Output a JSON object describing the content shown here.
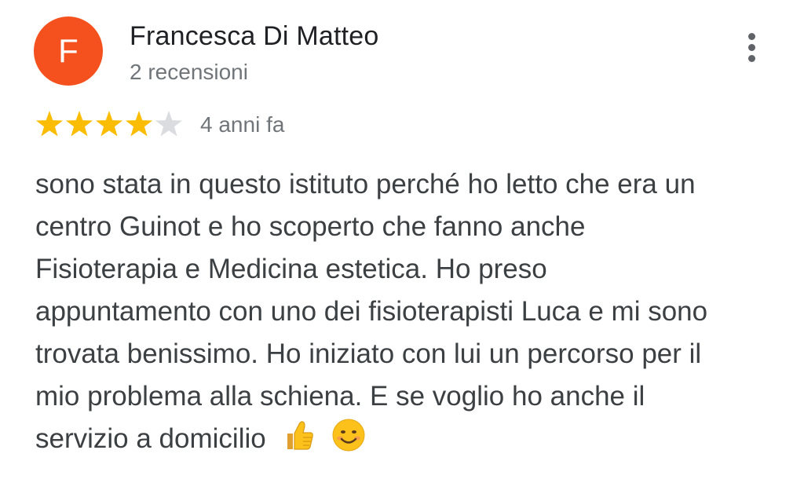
{
  "review": {
    "avatar_letter": "F",
    "avatar_color": "#f4511e",
    "author_name": "Francesca Di Matteo",
    "review_count": "2 recensioni",
    "rating": 4,
    "rating_max": 5,
    "star_color": "#fbbc04",
    "star_empty_color": "#dadce0",
    "date": "4 anni fa",
    "text": "sono stata in questo istituto perché ho letto che era un centro Guinot e ho scoperto che fanno anche Fisioterapia e Medicina estetica. Ho preso appuntamento con uno dei fisioterapisti Luca e mi sono trovata benissimo. Ho iniziato con lui un percorso per il mio problema alla schiena. E se voglio ho anche il servizio a domicilio",
    "emojis": [
      "thumbs-up-icon",
      "smiling-face-icon"
    ],
    "menu_icon": "more-vertical-icon"
  }
}
